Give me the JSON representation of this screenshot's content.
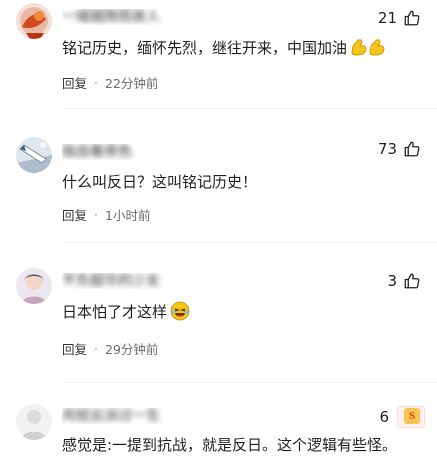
{
  "comments": [
    {
      "username": "一城烟雨揽故人",
      "likes": "21",
      "text": "铭记历史，缅怀先烈，继往开来，中国加油",
      "reply_label": "回复",
      "time": "22分钟前"
    },
    {
      "username": "独自看夜色",
      "likes": "73",
      "text": "什么叫反日？这叫铭记历史！",
      "reply_label": "回复",
      "time": "1小时前"
    },
    {
      "username": "不负韶华的少女",
      "likes": "3",
      "text": "日本怕了才这样",
      "reply_label": "回复",
      "time": "29分钟前"
    },
    {
      "username": "风轻云淡过一生",
      "likes": "6",
      "text": "感觉是:一提到抗战，就是反日。这个逻辑有些怪。",
      "reply_label": "回复",
      "time": ""
    }
  ],
  "icons": {
    "like": "thumbs-up-icon",
    "strong_emoji": "flexed-biceps-emoji",
    "laugh_emoji": "laughing-emoji",
    "sohu_logo": "sohu-s-icon"
  },
  "colors": {
    "text": "#1e1e1e",
    "meta": "#6b6b6b",
    "emoji_yellow": "#f5c518"
  }
}
